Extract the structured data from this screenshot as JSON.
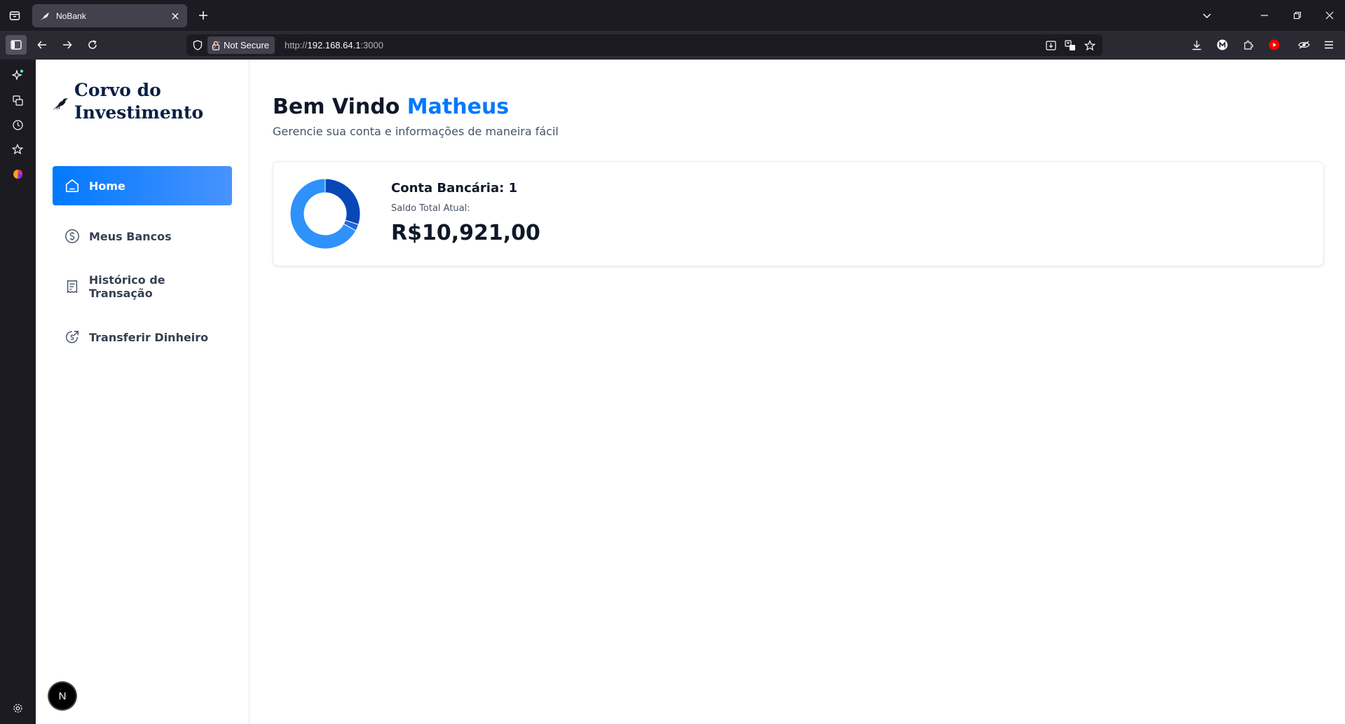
{
  "browser": {
    "tab_title": "NoBank",
    "security_label": "Not Secure",
    "url_scheme": "http://",
    "url_host": "192.168.64.1",
    "url_port": ":3000"
  },
  "sidebar": {
    "brand": "Corvo do Investimento",
    "items": [
      {
        "label": "Home",
        "icon": "home-icon",
        "active": true
      },
      {
        "label": "Meus Bancos",
        "icon": "dollar-circle-icon",
        "active": false
      },
      {
        "label": "Histórico de Transação",
        "icon": "receipt-icon",
        "active": false
      },
      {
        "label": "Transferir Dinheiro",
        "icon": "money-send-icon",
        "active": false
      }
    ],
    "badge": "N"
  },
  "header": {
    "greeting": "Bem Vindo",
    "user_name": "Matheus",
    "subtitle": "Gerencie sua conta e informações de maneira fácil"
  },
  "balance_card": {
    "accounts_label": "Conta Bancária: 1",
    "total_label": "Saldo Total Atual:",
    "total_value": "R$10,921,00"
  },
  "chart_data": {
    "type": "pie",
    "values": [
      30,
      3,
      67
    ],
    "colors": [
      "#0747b6",
      "#2265d8",
      "#2f91fa"
    ]
  },
  "colors": {
    "accent": "#0179fe",
    "text_primary": "#101828",
    "brand_text": "#0b1f44"
  }
}
